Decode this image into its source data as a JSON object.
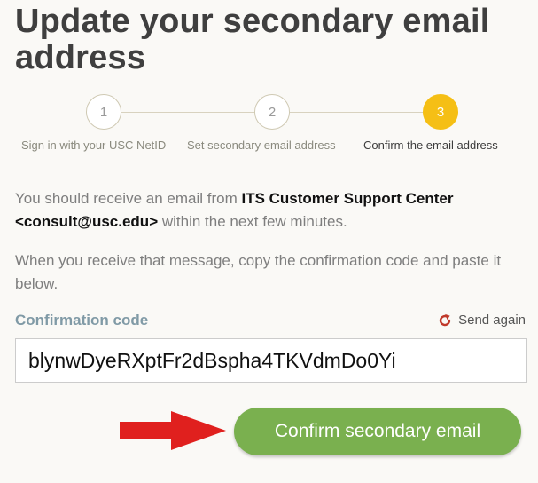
{
  "title": "Update your secondary email address",
  "steps": [
    {
      "number": "1",
      "label": "Sign in with your USC NetID",
      "active": false
    },
    {
      "number": "2",
      "label": "Set secondary email address",
      "active": false
    },
    {
      "number": "3",
      "label": "Confirm the email address",
      "active": true
    }
  ],
  "message": {
    "part1": "You should receive an email from ",
    "sender": "ITS Customer Support Center",
    "space": " ",
    "address": "<consult@usc.edu>",
    "part2": " within the next few minutes."
  },
  "instruction": "When you receive that message, copy the confirmation code and paste it below.",
  "form": {
    "code_label": "Confirmation code",
    "send_again_label": "Send again",
    "code_value": "blynwDyeRXptFr2dBspha4TKVdmDo0Yi",
    "confirm_label": "Confirm secondary email"
  },
  "colors": {
    "active_step": "#f5bf15",
    "confirm_button": "#7ab04f",
    "field_label": "#809aa6",
    "refresh_icon": "#c0392b",
    "arrow": "#e0201e"
  },
  "icons": {
    "send_again": "refresh-icon",
    "pointer": "right-arrow-icon"
  }
}
